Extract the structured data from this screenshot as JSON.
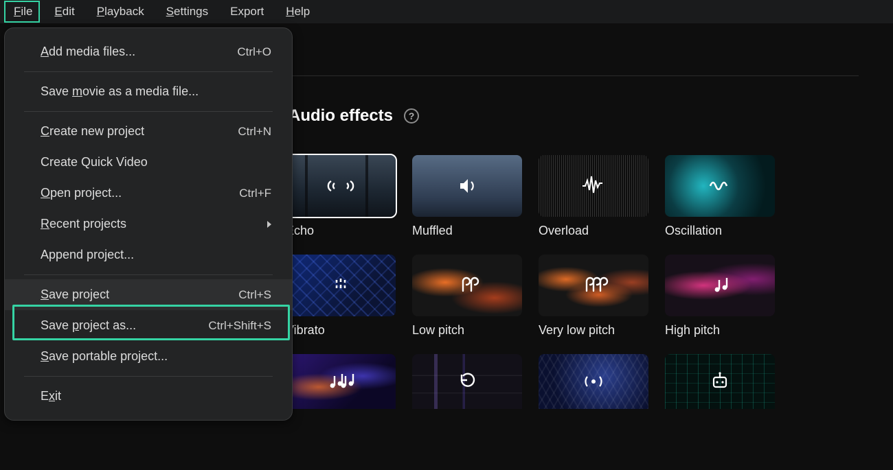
{
  "menubar": {
    "items": [
      "File",
      "Edit",
      "Playback",
      "Settings",
      "Export",
      "Help"
    ],
    "underlines": [
      "F",
      "E",
      "P",
      "S",
      "",
      "H"
    ]
  },
  "section": {
    "title": "Audio effects"
  },
  "dropdown": {
    "items": [
      {
        "label": "Add media files...",
        "shortcut": "Ctrl+O",
        "ul": "A"
      },
      {
        "sep": true
      },
      {
        "label": "Save movie as a media file...",
        "ul": "m"
      },
      {
        "sep": true
      },
      {
        "label": "Create new project",
        "shortcut": "Ctrl+N",
        "ul": "C"
      },
      {
        "label": "Create Quick Video"
      },
      {
        "label": "Open project...",
        "shortcut": "Ctrl+F",
        "ul": "O"
      },
      {
        "label": "Recent projects",
        "submenu": true,
        "ul": "R"
      },
      {
        "label": "Append project..."
      },
      {
        "sep": true
      },
      {
        "label": "Save project",
        "shortcut": "Ctrl+S",
        "ul": "S",
        "selected": true
      },
      {
        "label": "Save project as...",
        "shortcut": "Ctrl+Shift+S",
        "ul": "p"
      },
      {
        "label": "Save portable project...",
        "ul": "S"
      },
      {
        "sep": true
      },
      {
        "label": "Exit",
        "ul": "x"
      }
    ]
  },
  "effects": [
    {
      "label": "Echo",
      "icon": "echo",
      "bg": "bg-echo",
      "selected": true
    },
    {
      "label": "Muffled",
      "icon": "muffled",
      "bg": "bg-muffled"
    },
    {
      "label": "Overload",
      "icon": "wave",
      "bg": "bg-overload"
    },
    {
      "label": "Oscillation",
      "icon": "osc",
      "bg": "bg-oscillation"
    },
    {
      "label": "Vibrato",
      "icon": "vibrato",
      "bg": "bg-vibrato"
    },
    {
      "label": "Low pitch",
      "icon": "rho2",
      "bg": "bg-lowpitch"
    },
    {
      "label": "Very low pitch",
      "icon": "rho3",
      "bg": "bg-verylow"
    },
    {
      "label": "High pitch",
      "icon": "note2",
      "bg": "bg-highpitch"
    },
    {
      "label": "",
      "icon": "note3",
      "bg": "bg-hp4a",
      "row3": true
    },
    {
      "label": "",
      "icon": "cycle",
      "bg": "bg-glitch",
      "row3": true
    },
    {
      "label": "",
      "icon": "broadcast",
      "bg": "bg-mic",
      "row3": true
    },
    {
      "label": "",
      "icon": "robot",
      "bg": "bg-matrix",
      "row3": true
    }
  ]
}
